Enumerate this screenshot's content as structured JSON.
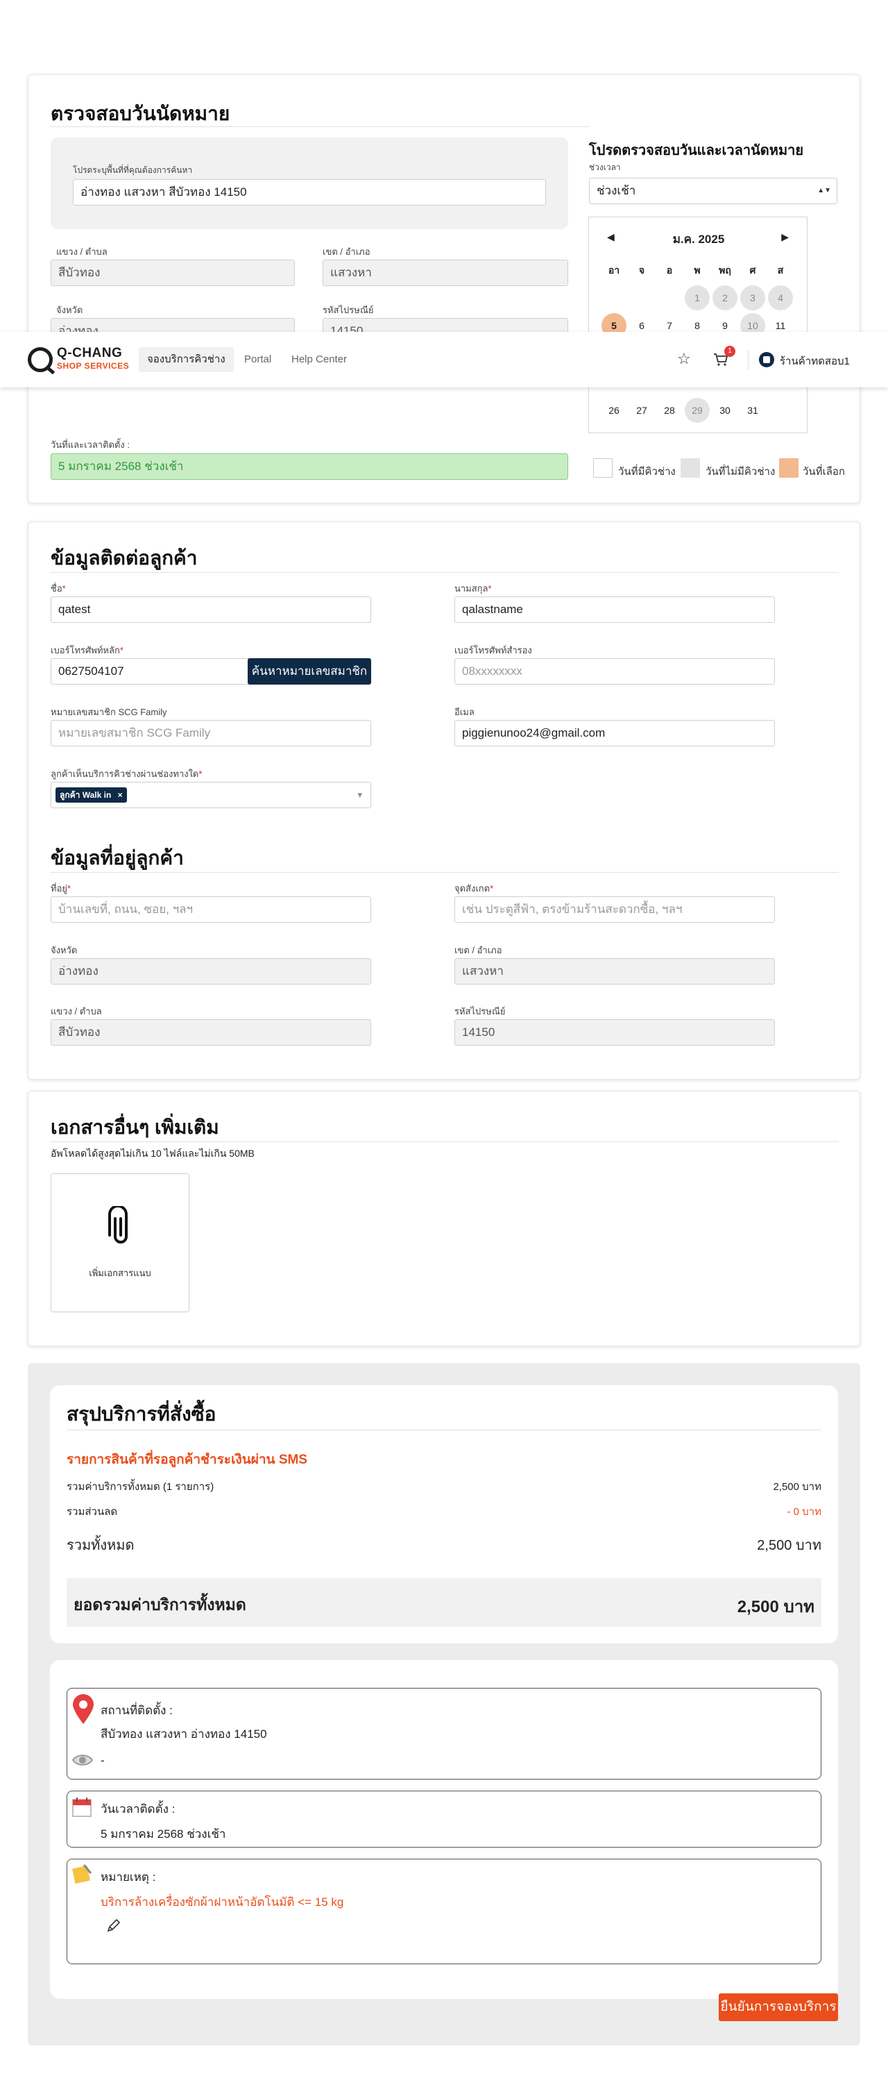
{
  "appointment": {
    "title": "ตรวจสอบวันนัดหมาย",
    "area_label": "โปรดระบุพื้นที่ที่คุณต้องการค้นหา",
    "area_value": "อ่างทอง แสวงหา สีบัวทอง 14150",
    "subdistrict_label": "แขวง / ตำบล",
    "subdistrict_value": "สีบัวทอง",
    "district_label": "เขต / อำเภอ",
    "district_value": "แสวงหา",
    "province_label": "จังหวัด",
    "province_value": "อ่างทอง",
    "postcode_label": "รหัสไปรษณีย์",
    "postcode_value": "14150",
    "datetime_label": "วันที่และเวลาติดตั้ง :",
    "datetime_value": "5 มกราคม 2568 ช่วงเช้า",
    "check_title": "โปรดตรวจสอบวันและเวลานัดหมาย",
    "slot_label": "ช่วงเวลา",
    "slot_value": "ช่วงเช้า",
    "calendar": {
      "prev": "◀",
      "next": "▶",
      "month": "ม.ค. 2025",
      "weekdays": [
        "อา",
        "จ",
        "อ",
        "พ",
        "พฤ",
        "ศ",
        "ส"
      ],
      "days": [
        "1",
        "2",
        "3",
        "4",
        "5",
        "6",
        "7",
        "8",
        "9",
        "10",
        "11",
        "26",
        "27",
        "28",
        "29",
        "30",
        "31"
      ]
    },
    "legend": {
      "available": "วันที่มีคิวช่าง",
      "unavailable": "วันที่ไม่มีคิวช่าง",
      "selected": "วันที่เลือก"
    }
  },
  "header": {
    "logo_top": "Q-CHANG",
    "logo_bottom": "SHOP SERVICES",
    "nav": [
      "จองบริการคิวช่าง",
      "Portal",
      "Help Center"
    ],
    "cart_count": "1",
    "shop_name": "ร้านค้าทดสอบ1"
  },
  "customer": {
    "title": "ข้อมูลติดต่อลูกค้า",
    "first_name_label": "ชื่อ",
    "first_name_value": "qatest",
    "last_name_label": "นามสกุล",
    "last_name_value": "qalastname",
    "phone_label": "เบอร์โทรศัพท์หลัก",
    "phone_value": "0627504107",
    "search_member_button": "ค้นหาหมายเลขสมาชิก",
    "alt_phone_label": "เบอร์โทรศัพท์สำรอง",
    "alt_phone_placeholder": "08xxxxxxxx",
    "member_label": "หมายเลขสมาชิก SCG Family",
    "member_placeholder": "หมายเลขสมาชิก SCG Family",
    "email_label": "อีเมล",
    "email_value": "piggienunoo24@gmail.com",
    "channel_label": "ลูกค้าเห็นบริการคิวช่างผ่านช่องทางใด",
    "channel_chip": "ลูกค้า Walk in",
    "channel_chip_remove": "×",
    "channel_caret": "▾",
    "req_mark": "*"
  },
  "address": {
    "title": "ข้อมูลที่อยู่ลูกค้า",
    "address_label": "ที่อยู่",
    "address_placeholder": "บ้านเลขที่, ถนน, ซอย, ฯลฯ",
    "landmark_label": "จุดสังเกต",
    "landmark_placeholder": "เช่น ประตูสีฟ้า, ตรงข้ามร้านสะดวกซื้อ, ฯลฯ",
    "province_label": "จังหวัด",
    "province_value": "อ่างทอง",
    "district_label": "เขต / อำเภอ",
    "district_value": "แสวงหา",
    "subdistrict_label": "แขวง / ตำบล",
    "subdistrict_value": "สีบัวทอง",
    "postcode_label": "รหัสไปรษณีย์",
    "postcode_value": "14150"
  },
  "documents": {
    "title": "เอกสารอื่นๆ เพิ่มเติม",
    "subtitle": "อัพโหลดได้สูงสุดไม่เกิน 10 ไฟล์และไม่เกิน 50MB",
    "add_label": "เพิ่มเอกสารแนบ"
  },
  "summary": {
    "title": "สรุปบริการที่สั่งซื้อ",
    "sms_heading": "รายการสินค้าที่รอลูกค้าชำระเงินผ่าน SMS",
    "subtotal_label": "รวมค่าบริการทั้งหมด (1 รายการ)",
    "subtotal_value": "2,500 บาท",
    "discount_label": "รวมส่วนลด",
    "discount_value": "- 0 บาท",
    "total_label": "รวมทั้งหมด",
    "total_value": "2,500 บาท",
    "grand_label": "ยอดรวมค่าบริการทั้งหมด",
    "grand_value": "2,500 บาท",
    "location_label": "สถานที่ติดตั้ง :",
    "location_value": "สีบัวทอง แสวงหา อ่างทอง 14150",
    "location_note": "-",
    "install_date_label": "วันเวลาติดตั้ง :",
    "install_date_value": "5 มกราคม 2568 ช่วงเช้า",
    "remark_label": "หมายเหตุ :",
    "remark_value": "บริการล้างเครื่องซักผ้าฝาหน้าอัตโนมัติ <= 15 kg",
    "confirm_button": "ยืนยันการจองบริการ"
  },
  "colors": {
    "brand_orange": "#e94e1b",
    "navy": "#0e2a47",
    "selected_day": "#f4b88d",
    "success_green": "#c8ecc4"
  }
}
